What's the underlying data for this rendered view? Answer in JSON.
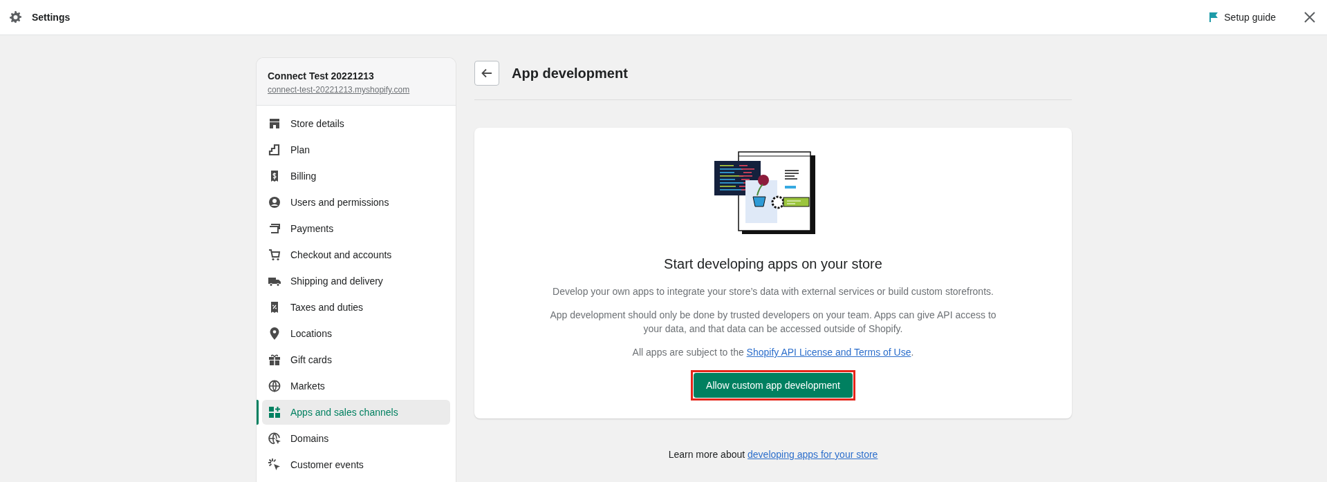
{
  "top_bar": {
    "title": "Settings",
    "setup_guide": "Setup guide"
  },
  "store": {
    "name": "Connect Test 20221213",
    "domain": "connect-test-20221213.myshopify.com"
  },
  "sidebar": {
    "items": [
      {
        "label": "Store details",
        "selected": false
      },
      {
        "label": "Plan",
        "selected": false
      },
      {
        "label": "Billing",
        "selected": false
      },
      {
        "label": "Users and permissions",
        "selected": false
      },
      {
        "label": "Payments",
        "selected": false
      },
      {
        "label": "Checkout and accounts",
        "selected": false
      },
      {
        "label": "Shipping and delivery",
        "selected": false
      },
      {
        "label": "Taxes and duties",
        "selected": false
      },
      {
        "label": "Locations",
        "selected": false
      },
      {
        "label": "Gift cards",
        "selected": false
      },
      {
        "label": "Markets",
        "selected": false
      },
      {
        "label": "Apps and sales channels",
        "selected": true
      },
      {
        "label": "Domains",
        "selected": false
      },
      {
        "label": "Customer events",
        "selected": false
      }
    ]
  },
  "page": {
    "title": "App development"
  },
  "card": {
    "heading": "Start developing apps on your store",
    "paragraphs": [
      "Develop your own apps to integrate your store’s data with external services or build custom storefronts.",
      "App development should only be done by trusted developers on your team. Apps can give API access to your data, and that data can be accessed outside of Shopify."
    ],
    "terms": {
      "before": "All apps are subject to the ",
      "link": "Shopify API License and Terms of Use",
      "after": "."
    },
    "button": {
      "label": "Allow custom app development",
      "highlighted": true
    }
  },
  "footer": {
    "before": "Learn more about ",
    "link": "developing apps for your store"
  }
}
